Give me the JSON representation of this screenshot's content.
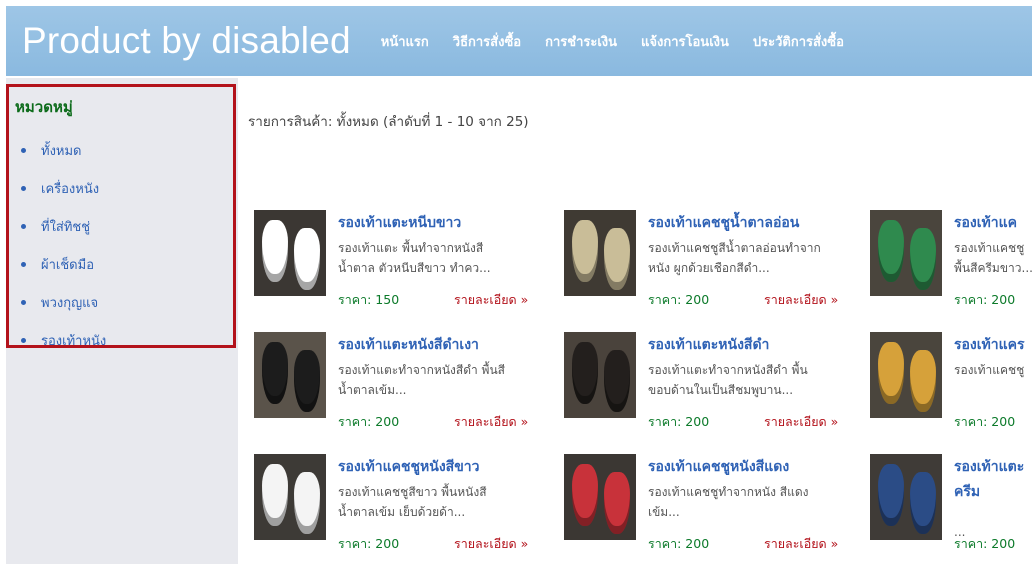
{
  "header": {
    "brand": "Product by disabled",
    "nav": [
      "หน้าแรก",
      "วิธีการสั่งซื้อ",
      "การชำระเงิน",
      "แจ้งการโอนเงิน",
      "ประวัติการสั่งซื้อ"
    ]
  },
  "sidebar": {
    "title": "หมวดหมู่",
    "items": [
      "ทั้งหมด",
      "เครื่องหนัง",
      "ที่ใส่ทิชชู่",
      "ผ้าเช็ดมือ",
      "พวงกุญแจ",
      "รองเท้าหนัง"
    ]
  },
  "main": {
    "summary": "รายการสินค้า: ทั้งหมด (ลำดับที่ 1 - 10 จาก 25)"
  },
  "products": [
    {
      "title": "รองเท้าแตะหนีบขาว",
      "desc1": "รองเท้าแตะ พื้นทำจากหนังสี",
      "desc2": "น้ำตาล ตัวหนีบสีขาว ทำคว...",
      "price": "ราคา: 150",
      "more": "รายละเอียด »",
      "shoe_color": "#ffffff",
      "bg": "#3b3733"
    },
    {
      "title": "รองเท้าแคชชูน้ำตาลอ่อน",
      "desc1": "รองเท้าแคชชูสีน้ำตาลอ่อนทำจาก",
      "desc2": "หนัง ผูกด้วยเชือกสีดำ...",
      "price": "ราคา: 200",
      "more": "รายละเอียด »",
      "shoe_color": "#c9bd98",
      "bg": "#3f3a33"
    },
    {
      "title": "รองเท้าแค",
      "desc1": "รองเท้าแคชชู",
      "desc2": "พื้นสีครีมขาว...",
      "price": "ราคา: 200",
      "more": "",
      "shoe_color": "#2f8a4e",
      "bg": "#4a453d"
    },
    {
      "title": "รองเท้าแตะหนังสีดำเงา",
      "desc1": "รองเท้าแตะทำจากหนังสีดำ พื้นสี",
      "desc2": "น้ำตาลเข้ม...",
      "price": "ราคา: 200",
      "more": "รายละเอียด »",
      "shoe_color": "#1c1c1c",
      "bg": "#5a534a"
    },
    {
      "title": "รองเท้าแตะหนังสีดำ",
      "desc1": "รองเท้าแตะทำจากหนังสีดำ พื้น",
      "desc2": "ขอบด้านในเป็นสีชมพูบาน...",
      "price": "ราคา: 200",
      "more": "รายละเอียด »",
      "shoe_color": "#231f1d",
      "bg": "#4a433c"
    },
    {
      "title": "รองเท้าแคร",
      "desc1": "รองเท้าแคชชู",
      "desc2": "",
      "price": "ราคา: 200",
      "more": "",
      "shoe_color": "#d6a13a",
      "bg": "#4a453d"
    },
    {
      "title": "รองเท้าแคชชูหนังสีขาว",
      "desc1": "รองเท้าแคชชูสีขาว พื้นหนังสี",
      "desc2": "น้ำตาลเข้ม เย็บด้วยด้า...",
      "price": "ราคา: 200",
      "more": "รายละเอียด »",
      "shoe_color": "#f4f4f4",
      "bg": "#3d3a36"
    },
    {
      "title": "รองเท้าแคชชูหนังสีแดง",
      "desc1": "รองเท้าแคชชูทำจากหนัง สีแดง",
      "desc2": "เข้ม...",
      "price": "ราคา: 200",
      "more": "รายละเอียด »",
      "shoe_color": "#c8323a",
      "bg": "#3b3733"
    },
    {
      "title": "รองเท้าแตะ",
      "desc1": "",
      "desc2": "...",
      "title2": "ครีม",
      "price": "ราคา: 200",
      "more": "",
      "shoe_color": "#2b4c86",
      "bg": "#3f3b37"
    }
  ]
}
